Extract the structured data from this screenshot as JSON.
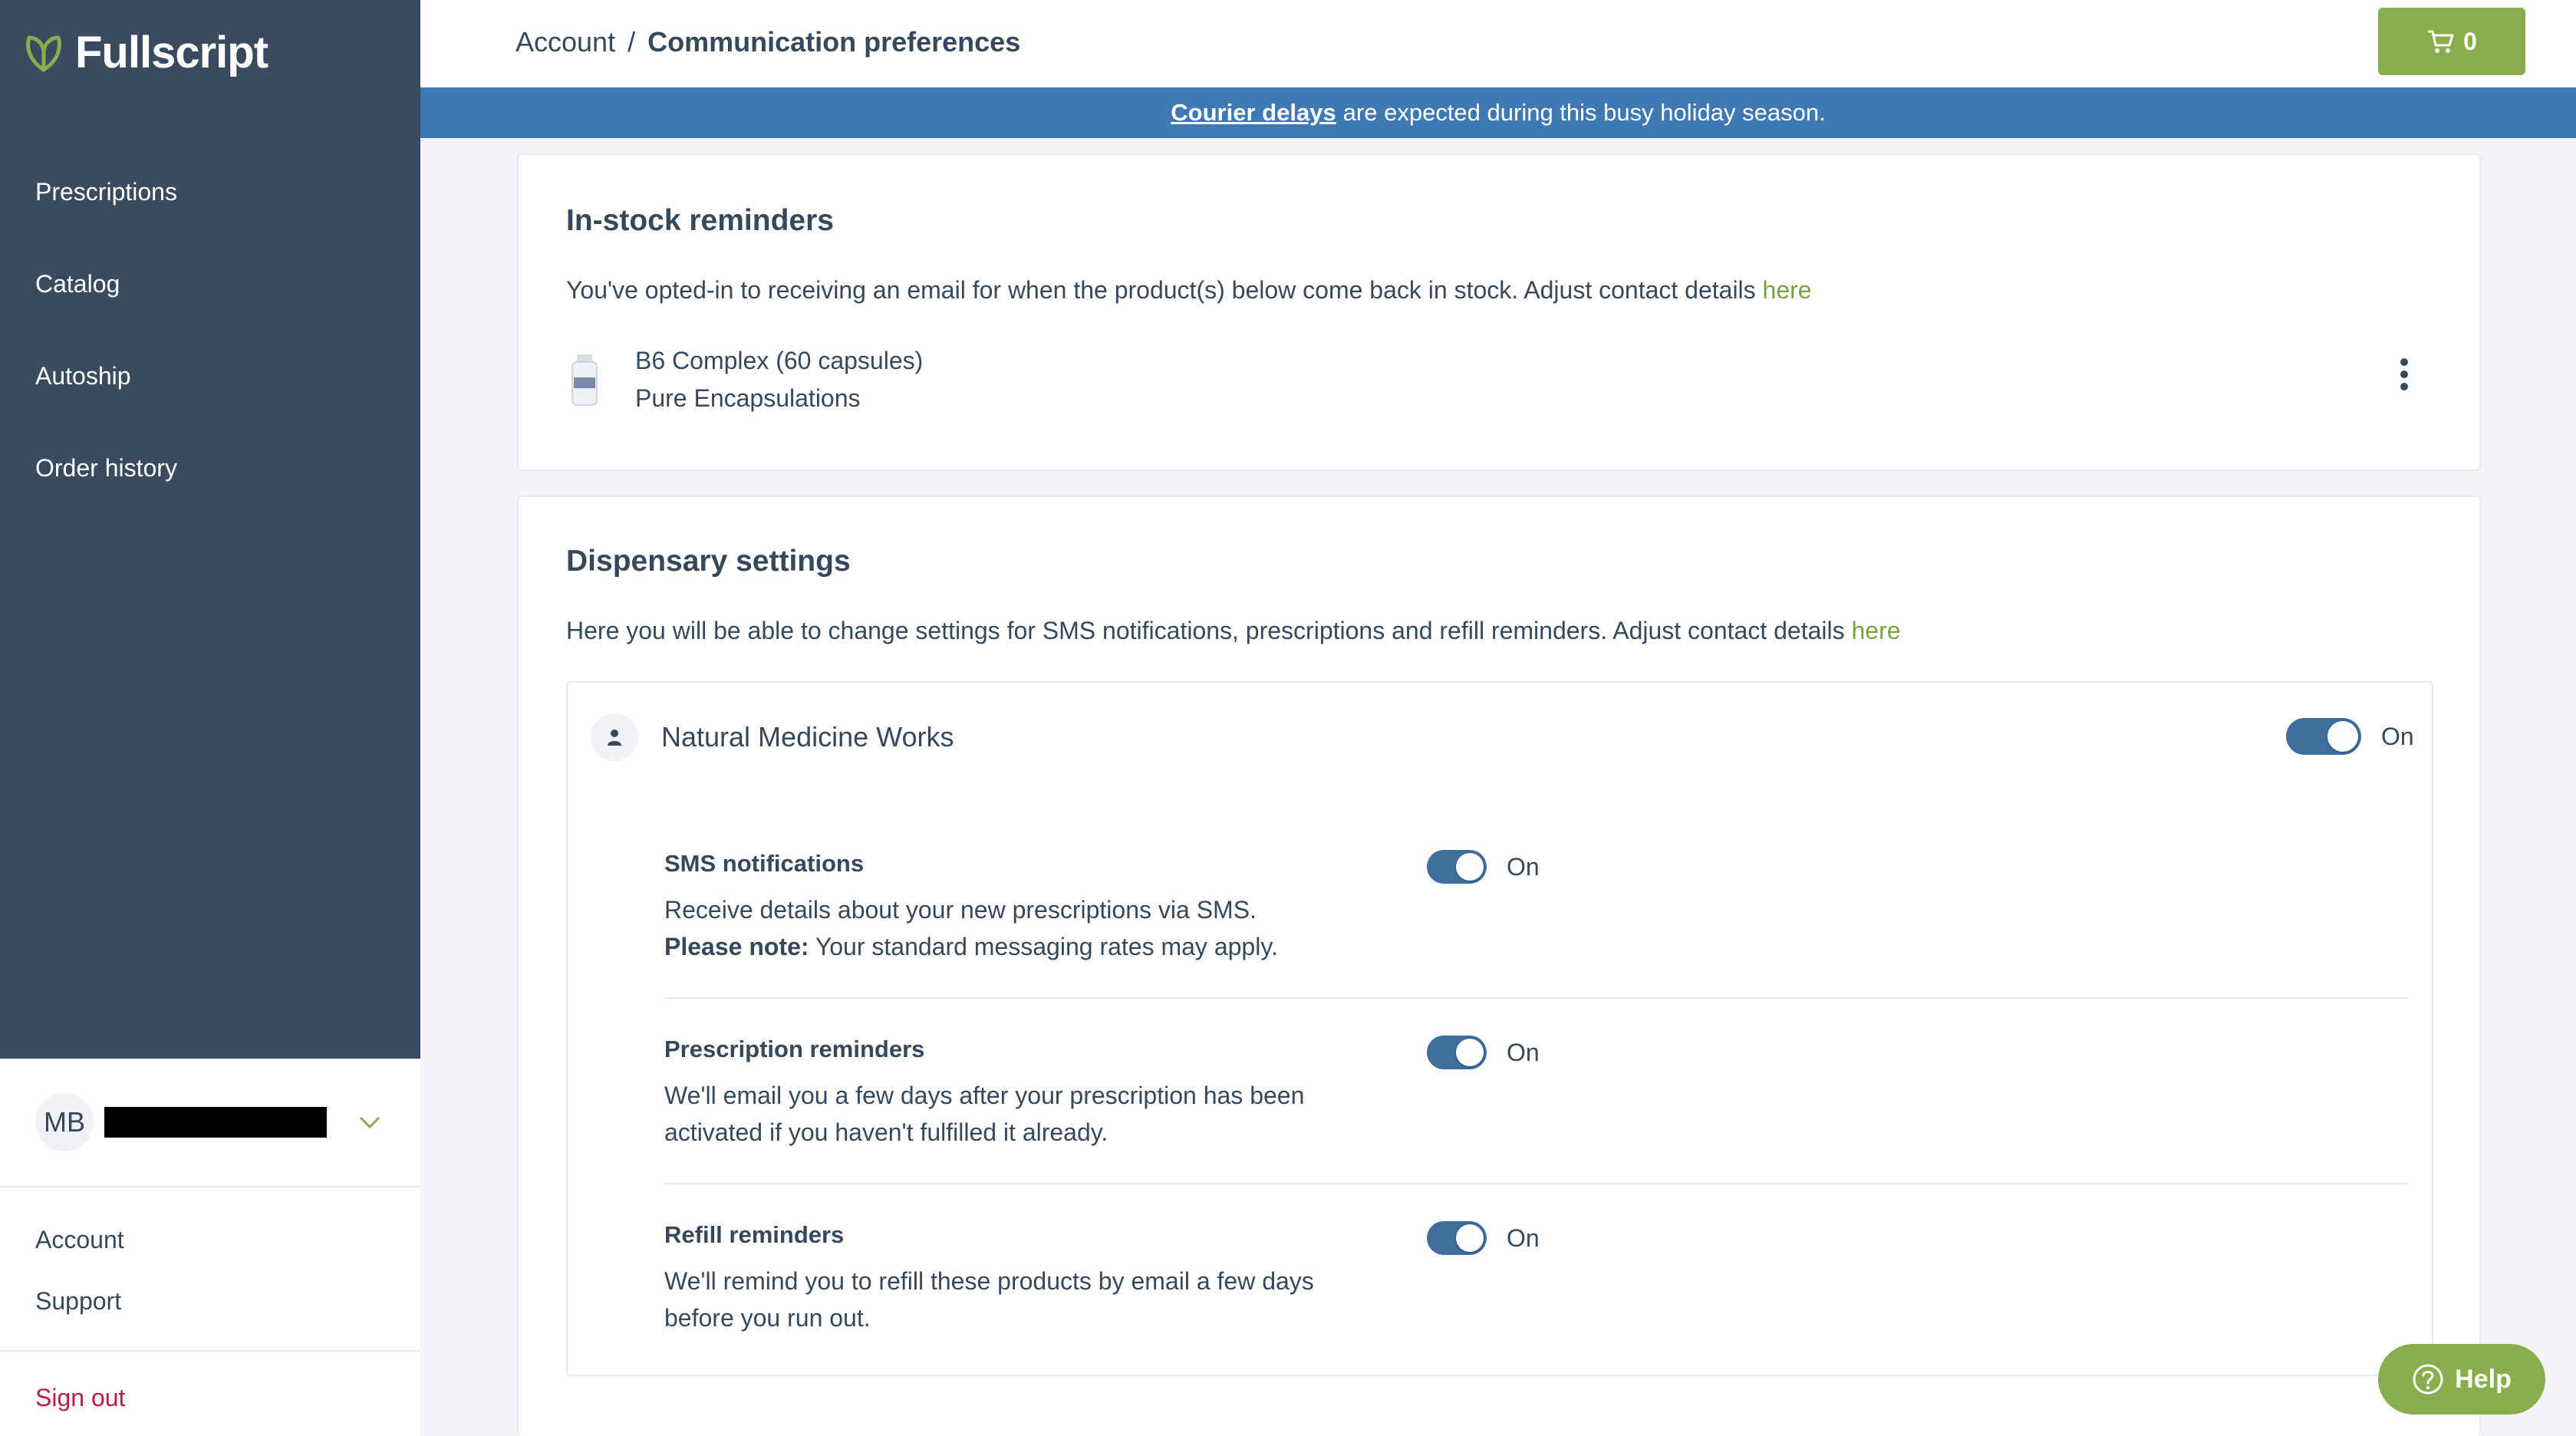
{
  "app": {
    "logo_text": "Fullscript"
  },
  "sidebar": {
    "items": [
      {
        "label": "Prescriptions"
      },
      {
        "label": "Catalog"
      },
      {
        "label": "Autoship"
      },
      {
        "label": "Order history"
      }
    ],
    "user": {
      "initials": "MB"
    },
    "links": [
      {
        "label": "Account"
      },
      {
        "label": "Support"
      }
    ],
    "sign_out": "Sign out"
  },
  "header": {
    "breadcrumb_root": "Account",
    "breadcrumb_sep": "/",
    "breadcrumb_current": "Communication preferences",
    "cart_count": "0"
  },
  "banner": {
    "link_text": "Courier delays",
    "text": "are expected during this busy holiday season."
  },
  "instock": {
    "title": "In-stock reminders",
    "desc": "You've opted-in to receiving an email for when the product(s) below come back in stock. Adjust contact details",
    "link": "here",
    "product": {
      "name": "B6 Complex (60 capsules)",
      "brand": "Pure Encapsulations"
    }
  },
  "dispensary": {
    "title": "Dispensary settings",
    "desc": "Here you will be able to change settings for SMS notifications, prescriptions and refill reminders. Adjust contact details",
    "link": "here",
    "practice": {
      "name": "Natural Medicine Works",
      "status": "On"
    },
    "settings": [
      {
        "title": "SMS notifications",
        "desc": "Receive details about your new prescriptions via SMS.",
        "note_label": "Please note:",
        "note": "Your standard messaging rates may apply.",
        "status": "On"
      },
      {
        "title": "Prescription reminders",
        "desc": "We'll email you a few days after your prescription has been activated if you haven't fulfilled it already.",
        "status": "On"
      },
      {
        "title": "Refill reminders",
        "desc": "We'll remind you to refill these products by email a few days before you run out.",
        "status": "On"
      }
    ]
  },
  "help": {
    "label": "Help"
  },
  "colors": {
    "sidebar": "#3a4a5f",
    "accent_green": "#88ad4d",
    "banner_blue": "#3f79b3",
    "toggle_on": "#3f6e9c",
    "sign_out_red": "#b51f45"
  }
}
